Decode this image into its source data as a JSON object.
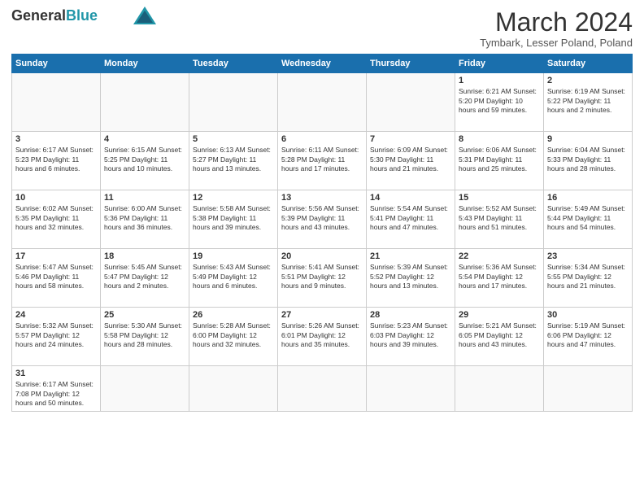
{
  "header": {
    "logo_general": "General",
    "logo_blue": "Blue",
    "title": "March 2024",
    "subtitle": "Tymbark, Lesser Poland, Poland"
  },
  "weekdays": [
    "Sunday",
    "Monday",
    "Tuesday",
    "Wednesday",
    "Thursday",
    "Friday",
    "Saturday"
  ],
  "weeks": [
    [
      {
        "day": "",
        "info": ""
      },
      {
        "day": "",
        "info": ""
      },
      {
        "day": "",
        "info": ""
      },
      {
        "day": "",
        "info": ""
      },
      {
        "day": "",
        "info": ""
      },
      {
        "day": "1",
        "info": "Sunrise: 6:21 AM\nSunset: 5:20 PM\nDaylight: 10 hours and 59 minutes."
      },
      {
        "day": "2",
        "info": "Sunrise: 6:19 AM\nSunset: 5:22 PM\nDaylight: 11 hours and 2 minutes."
      }
    ],
    [
      {
        "day": "3",
        "info": "Sunrise: 6:17 AM\nSunset: 5:23 PM\nDaylight: 11 hours and 6 minutes."
      },
      {
        "day": "4",
        "info": "Sunrise: 6:15 AM\nSunset: 5:25 PM\nDaylight: 11 hours and 10 minutes."
      },
      {
        "day": "5",
        "info": "Sunrise: 6:13 AM\nSunset: 5:27 PM\nDaylight: 11 hours and 13 minutes."
      },
      {
        "day": "6",
        "info": "Sunrise: 6:11 AM\nSunset: 5:28 PM\nDaylight: 11 hours and 17 minutes."
      },
      {
        "day": "7",
        "info": "Sunrise: 6:09 AM\nSunset: 5:30 PM\nDaylight: 11 hours and 21 minutes."
      },
      {
        "day": "8",
        "info": "Sunrise: 6:06 AM\nSunset: 5:31 PM\nDaylight: 11 hours and 25 minutes."
      },
      {
        "day": "9",
        "info": "Sunrise: 6:04 AM\nSunset: 5:33 PM\nDaylight: 11 hours and 28 minutes."
      }
    ],
    [
      {
        "day": "10",
        "info": "Sunrise: 6:02 AM\nSunset: 5:35 PM\nDaylight: 11 hours and 32 minutes."
      },
      {
        "day": "11",
        "info": "Sunrise: 6:00 AM\nSunset: 5:36 PM\nDaylight: 11 hours and 36 minutes."
      },
      {
        "day": "12",
        "info": "Sunrise: 5:58 AM\nSunset: 5:38 PM\nDaylight: 11 hours and 39 minutes."
      },
      {
        "day": "13",
        "info": "Sunrise: 5:56 AM\nSunset: 5:39 PM\nDaylight: 11 hours and 43 minutes."
      },
      {
        "day": "14",
        "info": "Sunrise: 5:54 AM\nSunset: 5:41 PM\nDaylight: 11 hours and 47 minutes."
      },
      {
        "day": "15",
        "info": "Sunrise: 5:52 AM\nSunset: 5:43 PM\nDaylight: 11 hours and 51 minutes."
      },
      {
        "day": "16",
        "info": "Sunrise: 5:49 AM\nSunset: 5:44 PM\nDaylight: 11 hours and 54 minutes."
      }
    ],
    [
      {
        "day": "17",
        "info": "Sunrise: 5:47 AM\nSunset: 5:46 PM\nDaylight: 11 hours and 58 minutes."
      },
      {
        "day": "18",
        "info": "Sunrise: 5:45 AM\nSunset: 5:47 PM\nDaylight: 12 hours and 2 minutes."
      },
      {
        "day": "19",
        "info": "Sunrise: 5:43 AM\nSunset: 5:49 PM\nDaylight: 12 hours and 6 minutes."
      },
      {
        "day": "20",
        "info": "Sunrise: 5:41 AM\nSunset: 5:51 PM\nDaylight: 12 hours and 9 minutes."
      },
      {
        "day": "21",
        "info": "Sunrise: 5:39 AM\nSunset: 5:52 PM\nDaylight: 12 hours and 13 minutes."
      },
      {
        "day": "22",
        "info": "Sunrise: 5:36 AM\nSunset: 5:54 PM\nDaylight: 12 hours and 17 minutes."
      },
      {
        "day": "23",
        "info": "Sunrise: 5:34 AM\nSunset: 5:55 PM\nDaylight: 12 hours and 21 minutes."
      }
    ],
    [
      {
        "day": "24",
        "info": "Sunrise: 5:32 AM\nSunset: 5:57 PM\nDaylight: 12 hours and 24 minutes."
      },
      {
        "day": "25",
        "info": "Sunrise: 5:30 AM\nSunset: 5:58 PM\nDaylight: 12 hours and 28 minutes."
      },
      {
        "day": "26",
        "info": "Sunrise: 5:28 AM\nSunset: 6:00 PM\nDaylight: 12 hours and 32 minutes."
      },
      {
        "day": "27",
        "info": "Sunrise: 5:26 AM\nSunset: 6:01 PM\nDaylight: 12 hours and 35 minutes."
      },
      {
        "day": "28",
        "info": "Sunrise: 5:23 AM\nSunset: 6:03 PM\nDaylight: 12 hours and 39 minutes."
      },
      {
        "day": "29",
        "info": "Sunrise: 5:21 AM\nSunset: 6:05 PM\nDaylight: 12 hours and 43 minutes."
      },
      {
        "day": "30",
        "info": "Sunrise: 5:19 AM\nSunset: 6:06 PM\nDaylight: 12 hours and 47 minutes."
      }
    ],
    [
      {
        "day": "31",
        "info": "Sunrise: 6:17 AM\nSunset: 7:08 PM\nDaylight: 12 hours and 50 minutes."
      },
      {
        "day": "",
        "info": ""
      },
      {
        "day": "",
        "info": ""
      },
      {
        "day": "",
        "info": ""
      },
      {
        "day": "",
        "info": ""
      },
      {
        "day": "",
        "info": ""
      },
      {
        "day": "",
        "info": ""
      }
    ]
  ]
}
